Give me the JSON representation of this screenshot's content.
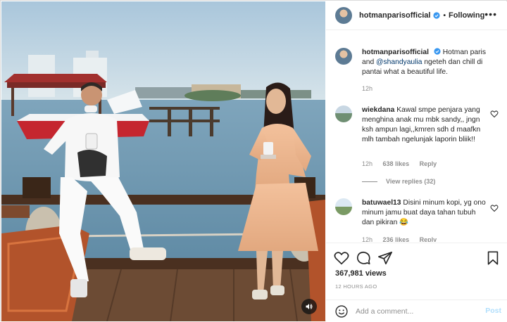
{
  "post": {
    "author": "hotmanparisofficial",
    "follow_state": "Following",
    "more_icon": "more-horizontal-icon",
    "caption_author": "hotmanparisofficial",
    "caption_pre": "Hotman paris and ",
    "caption_mention": "@shandyaulia",
    "caption_post": " ngeteh dan chill di pantai what a beautiful life.",
    "caption_time": "12h",
    "verified_color": "#3897f0"
  },
  "comments": [
    {
      "user": "wiekdana",
      "text": "Kawal smpe penjara yang menghina anak mu mbk sandy,, jngn ksh ampun lagi,,kmren sdh d maafkn mlh tambah ngelunjak laporin bliik!!",
      "time": "12h",
      "likes": "638 likes",
      "reply": "Reply",
      "view_replies": "View replies (32)"
    },
    {
      "user": "batuwael13",
      "text": "Disini minum kopi, yg ono minum jamu buat daya tahan tubuh dan pikiran 😂",
      "time": "12h",
      "likes": "236 likes",
      "reply": "Reply"
    }
  ],
  "actions": {
    "like_icon": "heart-icon",
    "comment_icon": "comment-icon",
    "share_icon": "share-icon",
    "save_icon": "bookmark-icon",
    "views": "367,981 views",
    "timestamp": "12 HOURS AGO"
  },
  "add_comment": {
    "emoji_icon": "emoji-icon",
    "placeholder": "Add a comment...",
    "post_label": "Post"
  },
  "media": {
    "sound_icon": "speaker-icon"
  }
}
